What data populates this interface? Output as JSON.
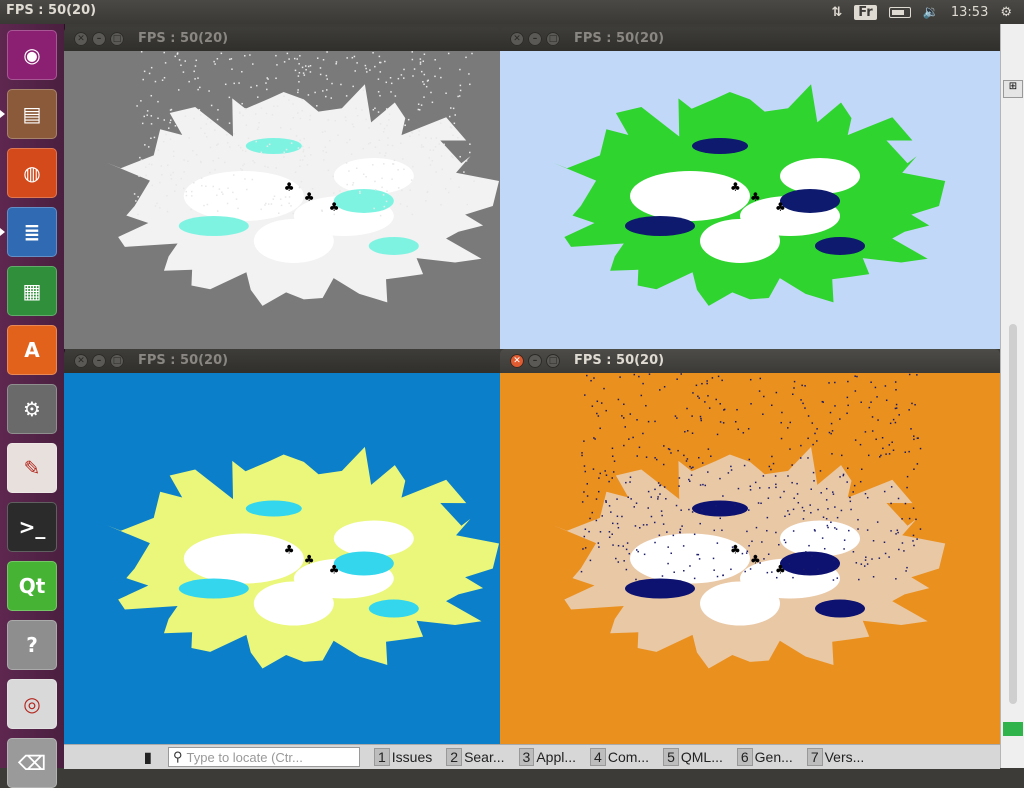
{
  "topbar": {
    "title": "FPS : 50(20)",
    "lang": "Fr",
    "time": "13:53"
  },
  "windows": [
    {
      "title": "FPS : 50(20)",
      "bg": "#7a7a7a",
      "terrain": "#f2f2f2",
      "accent": "#7ff3e2",
      "active": false
    },
    {
      "title": "FPS : 50(20)",
      "bg": "#c2d8f8",
      "terrain": "#2fd42f",
      "accent": "#0d1a6e",
      "active": false
    },
    {
      "title": "FPS : 50(20)",
      "bg": "#0b7fca",
      "terrain": "#eaf77a",
      "accent": "#34d6ee",
      "active": false
    },
    {
      "title": "FPS : 50(20)",
      "bg": "#ea901e",
      "terrain": "#e9c8a6",
      "accent": "#0d1270",
      "active": true
    }
  ],
  "launcher": [
    {
      "name": "ubuntu-icon",
      "color": "#8b1f72",
      "glyph": "◉"
    },
    {
      "name": "files-icon",
      "color": "#8b5a3a",
      "glyph": "▤"
    },
    {
      "name": "firefox-icon",
      "color": "#d44a1a",
      "glyph": "◍"
    },
    {
      "name": "writer-icon",
      "color": "#2f6ab3",
      "glyph": "≣"
    },
    {
      "name": "calc-icon",
      "color": "#2f8f3a",
      "glyph": "▦"
    },
    {
      "name": "software-center-icon",
      "color": "#e2621c",
      "glyph": "A"
    },
    {
      "name": "settings-icon",
      "color": "#6a6a6a",
      "glyph": "⚙"
    },
    {
      "name": "pdf-viewer-icon",
      "color": "#e7e0dc",
      "glyph": "✎"
    },
    {
      "name": "terminal-icon",
      "color": "#2b2b2b",
      "glyph": ">_"
    },
    {
      "name": "qt-creator-icon",
      "color": "#47b335",
      "glyph": "Qt"
    },
    {
      "name": "help-icon",
      "color": "#8e8e8e",
      "glyph": "?"
    },
    {
      "name": "dvd-icon",
      "color": "#d9d9d9",
      "glyph": "◎"
    },
    {
      "name": "trash-icon",
      "color": "#9a9a9a",
      "glyph": "⌫"
    }
  ],
  "bottom": {
    "search_placeholder": "Type to locate (Ctr...",
    "tabs": [
      {
        "n": "1",
        "label": "Issues"
      },
      {
        "n": "2",
        "label": "Sear..."
      },
      {
        "n": "3",
        "label": "Appl..."
      },
      {
        "n": "4",
        "label": "Com..."
      },
      {
        "n": "5",
        "label": "QML..."
      },
      {
        "n": "6",
        "label": "Gen..."
      },
      {
        "n": "7",
        "label": "Vers..."
      }
    ]
  }
}
